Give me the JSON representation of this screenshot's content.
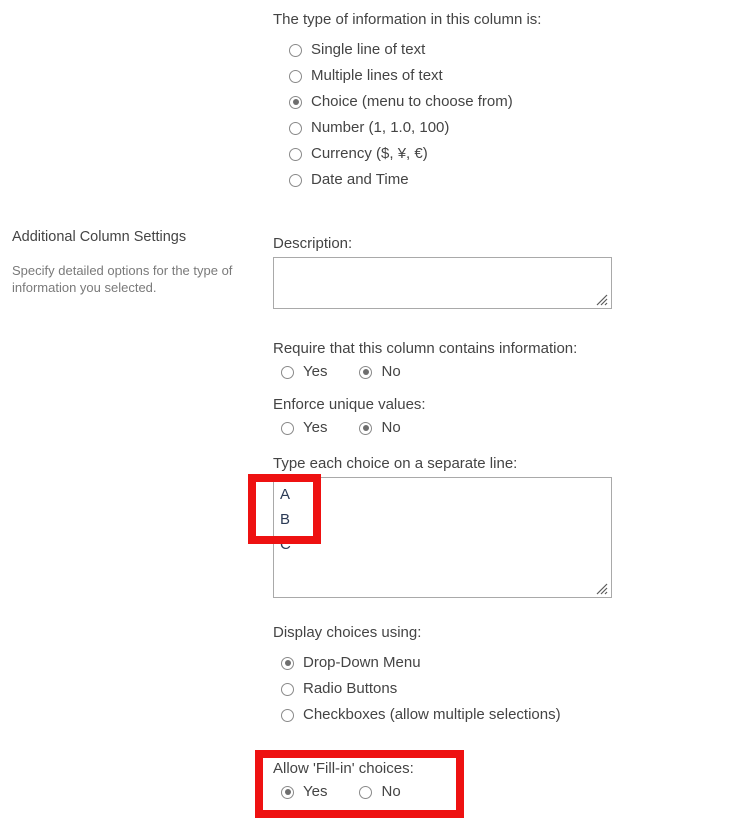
{
  "sidebar": {
    "heading": "Additional Column Settings",
    "description": "Specify detailed options for the type of information you selected."
  },
  "form": {
    "column_type": {
      "label": "The type of information in this column is:",
      "options": [
        {
          "label": "Single line of text",
          "selected": false
        },
        {
          "label": "Multiple lines of text",
          "selected": false
        },
        {
          "label": "Choice (menu to choose from)",
          "selected": true
        },
        {
          "label": "Number (1, 1.0, 100)",
          "selected": false
        },
        {
          "label": "Currency ($, ¥, €)",
          "selected": false
        },
        {
          "label": "Date and Time",
          "selected": false
        }
      ]
    },
    "description_field": {
      "label": "Description:",
      "value": ""
    },
    "require_info": {
      "label": "Require that this column contains information:",
      "yes_label": "Yes",
      "no_label": "No",
      "selected": "No"
    },
    "enforce_unique": {
      "label": "Enforce unique values:",
      "yes_label": "Yes",
      "no_label": "No",
      "selected": "No"
    },
    "choices_field": {
      "label": "Type each choice on a separate line:",
      "lines": [
        "A",
        "B",
        "C"
      ]
    },
    "display_choices": {
      "label": "Display choices using:",
      "options": [
        {
          "label": "Drop-Down Menu",
          "selected": true
        },
        {
          "label": "Radio Buttons",
          "selected": false
        },
        {
          "label": "Checkboxes (allow multiple selections)",
          "selected": false
        }
      ]
    },
    "fill_in": {
      "label": "Allow 'Fill-in' choices:",
      "yes_label": "Yes",
      "no_label": "No",
      "selected": "Yes"
    }
  },
  "annotations": {
    "accent_color": "#ee1111",
    "boxes": [
      {
        "name": "choices-textarea-highlight"
      },
      {
        "name": "fill-in-choices-highlight"
      }
    ]
  }
}
